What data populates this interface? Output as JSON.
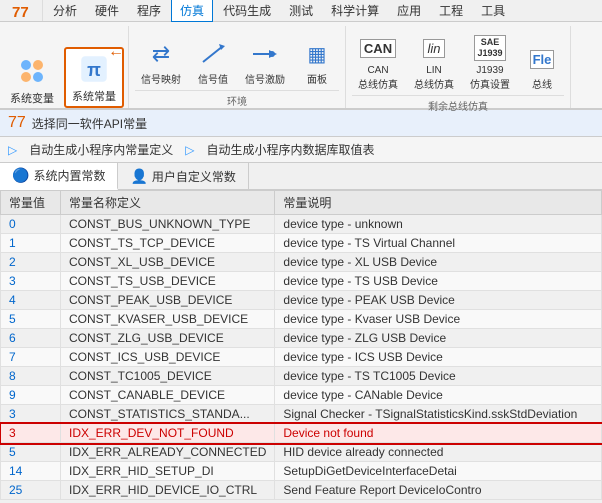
{
  "logo": "77",
  "menuBar": {
    "items": [
      "分析",
      "硬件",
      "程序",
      "仿真",
      "代码生成",
      "测试",
      "科学计算",
      "应用",
      "工程",
      "工具"
    ]
  },
  "ribbon": {
    "activeMenu": "仿真",
    "groups": [
      {
        "label": "",
        "buttons": [
          {
            "id": "sysvar",
            "icon": "⚙",
            "label": "系统变量",
            "active": false
          },
          {
            "id": "sysconst",
            "icon": "π",
            "label": "系统常量",
            "active": true
          }
        ]
      },
      {
        "label": "环境",
        "buttons": [
          {
            "id": "sigmap",
            "icon": "⇄",
            "label": "信号映射",
            "active": false
          },
          {
            "id": "sigval",
            "icon": "✎",
            "label": "信号值",
            "active": false
          },
          {
            "id": "sigstimu",
            "icon": "→●",
            "label": "信号激励",
            "active": false
          },
          {
            "id": "panel",
            "icon": "▦",
            "label": "面板",
            "active": false
          }
        ]
      },
      {
        "label": "剩余总线仿真",
        "buttons": [
          {
            "id": "cansim",
            "icon": "CAN",
            "label": "CAN\n总线仿真",
            "active": false
          },
          {
            "id": "linsim",
            "icon": "lin",
            "label": "LIN\n总线仿真",
            "active": false
          },
          {
            "id": "j1939sim",
            "icon": "SAE\nJ1939",
            "label": "J1939\n仿真设置",
            "active": false
          },
          {
            "id": "flexi",
            "icon": "Fle",
            "label": "总线",
            "active": false
          }
        ]
      }
    ]
  },
  "apiSelectBar": {
    "label": "选择同一软件API常量"
  },
  "subToolbar": {
    "autoGenConst": "自动生成小程序内常量定义",
    "autoGenTable": "自动生成小程序内数据库取值表"
  },
  "tabs": [
    {
      "id": "system",
      "icon": "🔵",
      "label": "系统内置常数",
      "active": true
    },
    {
      "id": "user",
      "icon": "👤",
      "label": "用户自定义常数",
      "active": false
    }
  ],
  "table": {
    "headers": [
      "常量值",
      "常量名称定义",
      "常量说明"
    ],
    "rows": [
      {
        "value": "0",
        "name": "CONST_BUS_UNKNOWN_TYPE",
        "desc": "device type - unknown",
        "selected": false
      },
      {
        "value": "1",
        "name": "CONST_TS_TCP_DEVICE",
        "desc": "device type - TS Virtual Channel",
        "selected": false
      },
      {
        "value": "2",
        "name": "CONST_XL_USB_DEVICE",
        "desc": "device type - XL USB Device",
        "selected": false
      },
      {
        "value": "3",
        "name": "CONST_TS_USB_DEVICE",
        "desc": "device type - TS USB Device",
        "selected": false
      },
      {
        "value": "4",
        "name": "CONST_PEAK_USB_DEVICE",
        "desc": "device type - PEAK USB Device",
        "selected": false
      },
      {
        "value": "5",
        "name": "CONST_KVASER_USB_DEVICE",
        "desc": "device type - Kvaser USB Device",
        "selected": false
      },
      {
        "value": "6",
        "name": "CONST_ZLG_USB_DEVICE",
        "desc": "device type - ZLG USB Device",
        "selected": false
      },
      {
        "value": "7",
        "name": "CONST_ICS_USB_DEVICE",
        "desc": "device type - ICS USB Device",
        "selected": false
      },
      {
        "value": "8",
        "name": "CONST_TC1005_DEVICE",
        "desc": "device type - TS TC1005 Device",
        "selected": false
      },
      {
        "value": "9",
        "name": "CONST_CANABLE_DEVICE",
        "desc": "device type - CANable Device",
        "selected": false
      },
      {
        "value": "3",
        "name": "CONST_STATISTICS_STANDA...",
        "desc": "Signal Checker - TSignalStatisticsKind.sskStdDeviation",
        "selected": false
      },
      {
        "value": "3",
        "name": "IDX_ERR_DEV_NOT_FOUND",
        "desc": "Device not found",
        "selected": true
      },
      {
        "value": "5",
        "name": "IDX_ERR_ALREADY_CONNECTED",
        "desc": "HID device already connected",
        "selected": false
      },
      {
        "value": "14",
        "name": "IDX_ERR_HID_SETUP_DI",
        "desc": "SetupDiGetDeviceInterfaceDetai",
        "selected": false
      },
      {
        "value": "25",
        "name": "IDX_ERR_HID_DEVICE_IO_CTRL",
        "desc": "Send Feature Report DeviceIoContro",
        "selected": false
      }
    ]
  }
}
